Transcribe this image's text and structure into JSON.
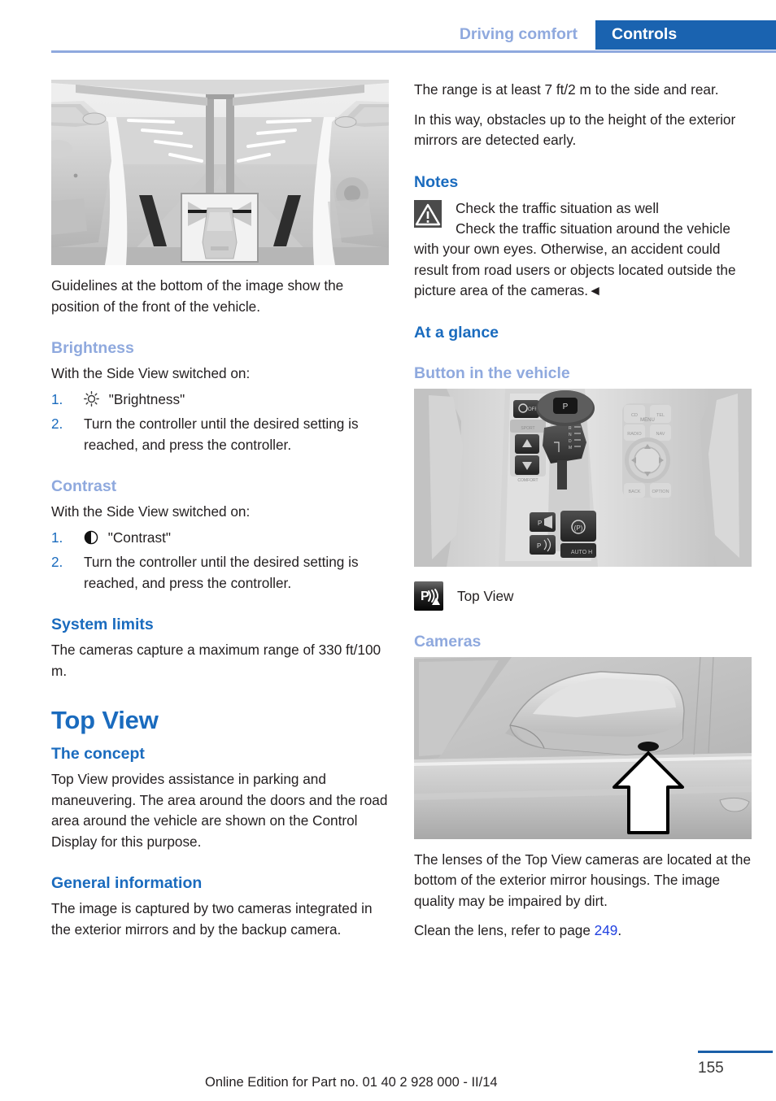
{
  "header": {
    "inactive_tab": "Driving comfort",
    "active_tab": "Controls",
    "accent_dark": "#1a63b0",
    "accent_light": "#8fa9de"
  },
  "left_column": {
    "figure_sideview_caption": "Guidelines at the bottom of the image show the position of the front of the vehicle.",
    "brightness": {
      "heading": "Brightness",
      "intro": "With the Side View switched on:",
      "steps": [
        {
          "num": "1.",
          "icon": "sun-icon",
          "text": "\"Brightness\""
        },
        {
          "num": "2.",
          "icon": "",
          "text": "Turn the controller until the desired setting is reached, and press the controller."
        }
      ]
    },
    "contrast": {
      "heading": "Contrast",
      "intro": "With the Side View switched on:",
      "steps": [
        {
          "num": "1.",
          "icon": "contrast-icon",
          "text": "\"Contrast\""
        },
        {
          "num": "2.",
          "icon": "",
          "text": "Turn the controller until the desired setting is reached, and press the controller."
        }
      ]
    },
    "system_limits": {
      "heading": "System limits",
      "text": "The cameras capture a maximum range of 330 ft/100 m."
    },
    "top_view_chapter": "Top View",
    "the_concept": {
      "heading": "The concept",
      "text": "Top View provides assistance in parking and maneuvering. The area around the doors and the road area around the vehicle are shown on the Control Display for this purpose."
    },
    "general_information": {
      "heading": "General information",
      "text": "The image is captured by two cameras integrated in the exterior mirrors and by the backup camera."
    }
  },
  "right_column": {
    "para_range": "The range is at least 7 ft/2 m to the side and rear.",
    "para_obstacles": "In this way, obstacles up to the height of the exterior mirrors are detected early.",
    "notes": {
      "heading": "Notes",
      "warning_title": "Check the traffic situation as well",
      "warning_body": "Check the traffic situation around the vehicle with your own eyes. Otherwise, an accident could result from road users or objects located outside the picture area of the cameras.◄"
    },
    "at_a_glance": "At a glance",
    "button_in_the_vehicle": "Button in the vehicle",
    "button_legend_label": "Top View",
    "cameras_heading": "Cameras",
    "cameras_text": "The lenses of the Top View cameras are located at the bottom of the exterior mirror housings. The image quality may be impaired by dirt.",
    "clean_lens_prefix": "Clean the lens, refer to page ",
    "clean_lens_page": "249",
    "clean_lens_suffix": "."
  },
  "footer": {
    "edition_text": "Online Edition for Part no. 01 40 2 928 000 - II/14",
    "page_number": "155"
  }
}
